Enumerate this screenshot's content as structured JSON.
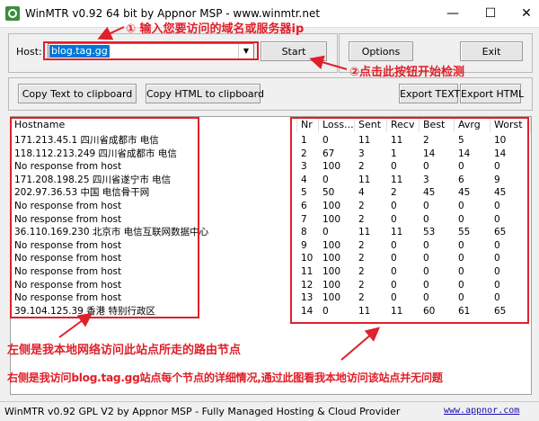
{
  "window": {
    "title": "WinMTR v0.92 64 bit by Appnor MSP - www.winmtr.net",
    "min": "—",
    "max": "☐",
    "close": "✕"
  },
  "host": {
    "label": "Host:",
    "value": "blog.tag.gg",
    "start_label": "Start",
    "options_label": "Options",
    "exit_label": "Exit"
  },
  "export": {
    "copy_text": "Copy Text to clipboard",
    "copy_html": "Copy HTML to clipboard",
    "export_text": "Export TEXT",
    "export_html": "Export HTML"
  },
  "table": {
    "columns": [
      "Hostname",
      "Nr",
      "Loss...",
      "Sent",
      "Recv",
      "Best",
      "Avrg",
      "Worst"
    ],
    "rows": [
      [
        "171.213.45.1 四川省成都市 电信",
        "1",
        "0",
        "11",
        "11",
        "2",
        "5",
        "10"
      ],
      [
        "118.112.213.249 四川省成都市 电信",
        "2",
        "67",
        "3",
        "1",
        "14",
        "14",
        "14"
      ],
      [
        "No response from host",
        "3",
        "100",
        "2",
        "0",
        "0",
        "0",
        "0"
      ],
      [
        "171.208.198.25 四川省遂宁市 电信",
        "4",
        "0",
        "11",
        "11",
        "3",
        "6",
        "9"
      ],
      [
        "202.97.36.53 中国 电信骨干网",
        "5",
        "50",
        "4",
        "2",
        "45",
        "45",
        "45"
      ],
      [
        "No response from host",
        "6",
        "100",
        "2",
        "0",
        "0",
        "0",
        "0"
      ],
      [
        "No response from host",
        "7",
        "100",
        "2",
        "0",
        "0",
        "0",
        "0"
      ],
      [
        "36.110.169.230 北京市 电信互联网数据中心",
        "8",
        "0",
        "11",
        "11",
        "53",
        "55",
        "65"
      ],
      [
        "No response from host",
        "9",
        "100",
        "2",
        "0",
        "0",
        "0",
        "0"
      ],
      [
        "No response from host",
        "10",
        "100",
        "2",
        "0",
        "0",
        "0",
        "0"
      ],
      [
        "No response from host",
        "11",
        "100",
        "2",
        "0",
        "0",
        "0",
        "0"
      ],
      [
        "No response from host",
        "12",
        "100",
        "2",
        "0",
        "0",
        "0",
        "0"
      ],
      [
        "No response from host",
        "13",
        "100",
        "2",
        "0",
        "0",
        "0",
        "0"
      ],
      [
        "39.104.125.39 香港 特别行政区",
        "14",
        "0",
        "11",
        "11",
        "60",
        "61",
        "65"
      ]
    ]
  },
  "status": {
    "text": "WinMTR v0.92 GPL V2 by Appnor MSP - Fully Managed Hosting & Cloud Provider",
    "link": "www.appnor.com"
  },
  "annotations": {
    "a1": "① 输入您要访问的域名或服务器ip",
    "a2": "②点击此按钮开始检测",
    "a3": "左侧是我本地网络访问此站点所走的路由节点",
    "a4": "右侧是我访问blog.tag.gg站点每个节点的详细情况,通过此图看我本地访问该站点并无问题",
    "color": "#e0202a"
  }
}
